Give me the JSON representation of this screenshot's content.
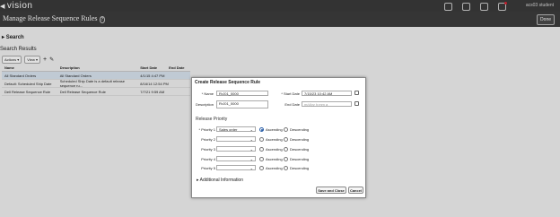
{
  "app": {
    "brand": "vision",
    "user": "acs03 student",
    "title": "Manage Release Sequence Rules",
    "done_label": "Done"
  },
  "search": {
    "label": "Search"
  },
  "results": {
    "title": "Search Results",
    "toolbar": {
      "actions": "Actions",
      "view": "View"
    },
    "columns": [
      "Name",
      "Description",
      "Start Date",
      "End Date"
    ],
    "rows": [
      [
        "All Standard Orders",
        "All Standard Orders",
        "4/1/15 4:47 PM",
        ""
      ],
      [
        "Default: Scheduled Ship Date",
        "Scheduled Ship Date is a default release sequence ru...",
        "8/16/14 12:54 PM",
        ""
      ],
      [
        "Dell Release Sequence Rule",
        "Dell Release Sequence Rule",
        "7/7/21 9:59 AM",
        ""
      ]
    ]
  },
  "dialog": {
    "title": "Create Release Sequence Rule",
    "name_label": "Name",
    "name_value": "RrJ01_0000",
    "description_label": "Description",
    "description_value": "RrJ01_0000",
    "start_date_label": "Start Date",
    "start_date_value": "7/15/23 10:42 AM",
    "end_date_label": "End Date",
    "end_date_placeholder": "m/d/yy h:mm a",
    "release_priority_label": "Release Priority",
    "priorities": [
      {
        "label": "Priority 1",
        "value": "Sales order",
        "required": true
      },
      {
        "label": "Priority 2",
        "value": "",
        "required": false
      },
      {
        "label": "Priority 3",
        "value": "",
        "required": false
      },
      {
        "label": "Priority 4",
        "value": "",
        "required": false
      },
      {
        "label": "Priority 5",
        "value": "",
        "required": false
      }
    ],
    "ascending_label": "Ascending",
    "descending_label": "Descending",
    "additional_info_label": "Additional Information",
    "save_close_label": "Save and Close",
    "cancel_label": "Cancel"
  }
}
